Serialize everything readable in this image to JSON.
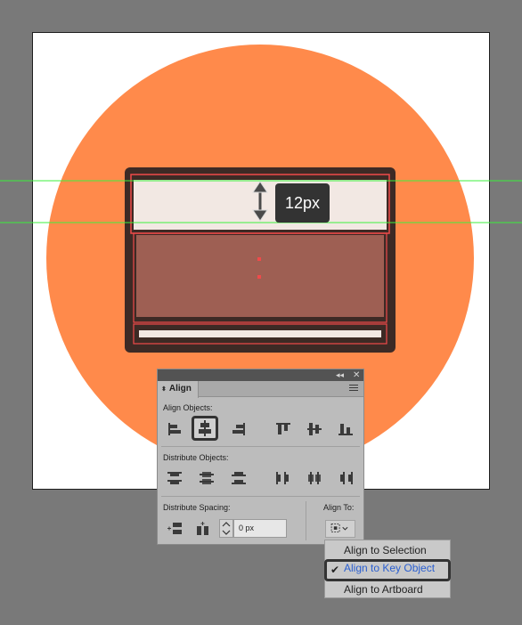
{
  "canvas": {
    "background_color": "#797979",
    "artboard_color": "#ffffff",
    "circle_color": "#ff8a4b",
    "outline_color": "#3d2a25",
    "top_fill_color": "#f2e8e3",
    "middle_fill_color": "#9e5f53",
    "guide_color": "#3cf03c",
    "selection_color": "#f04a4a",
    "measurement_label": "12px"
  },
  "align_panel": {
    "tab_title": "Align",
    "align_objects_label": "Align Objects:",
    "distribute_objects_label": "Distribute Objects:",
    "distribute_spacing_label": "Distribute Spacing:",
    "align_to_label": "Align To:",
    "spacing_value": "0 px",
    "align_object_icons": [
      "horizontal-align-left-icon",
      "horizontal-align-center-icon",
      "horizontal-align-right-icon",
      "vertical-align-top-icon",
      "vertical-align-center-icon",
      "vertical-align-bottom-icon"
    ],
    "distribute_object_icons": [
      "vertical-distribute-top-icon",
      "vertical-distribute-center-icon",
      "vertical-distribute-bottom-icon",
      "horizontal-distribute-left-icon",
      "horizontal-distribute-center-icon",
      "horizontal-distribute-right-icon"
    ],
    "active_icon": "horizontal-align-center-icon"
  },
  "align_to_menu": {
    "items": [
      "Align to Selection",
      "Align to Key Object",
      "Align to Artboard"
    ],
    "selected": "Align to Key Object",
    "selected_color": "#2a5fd1"
  }
}
